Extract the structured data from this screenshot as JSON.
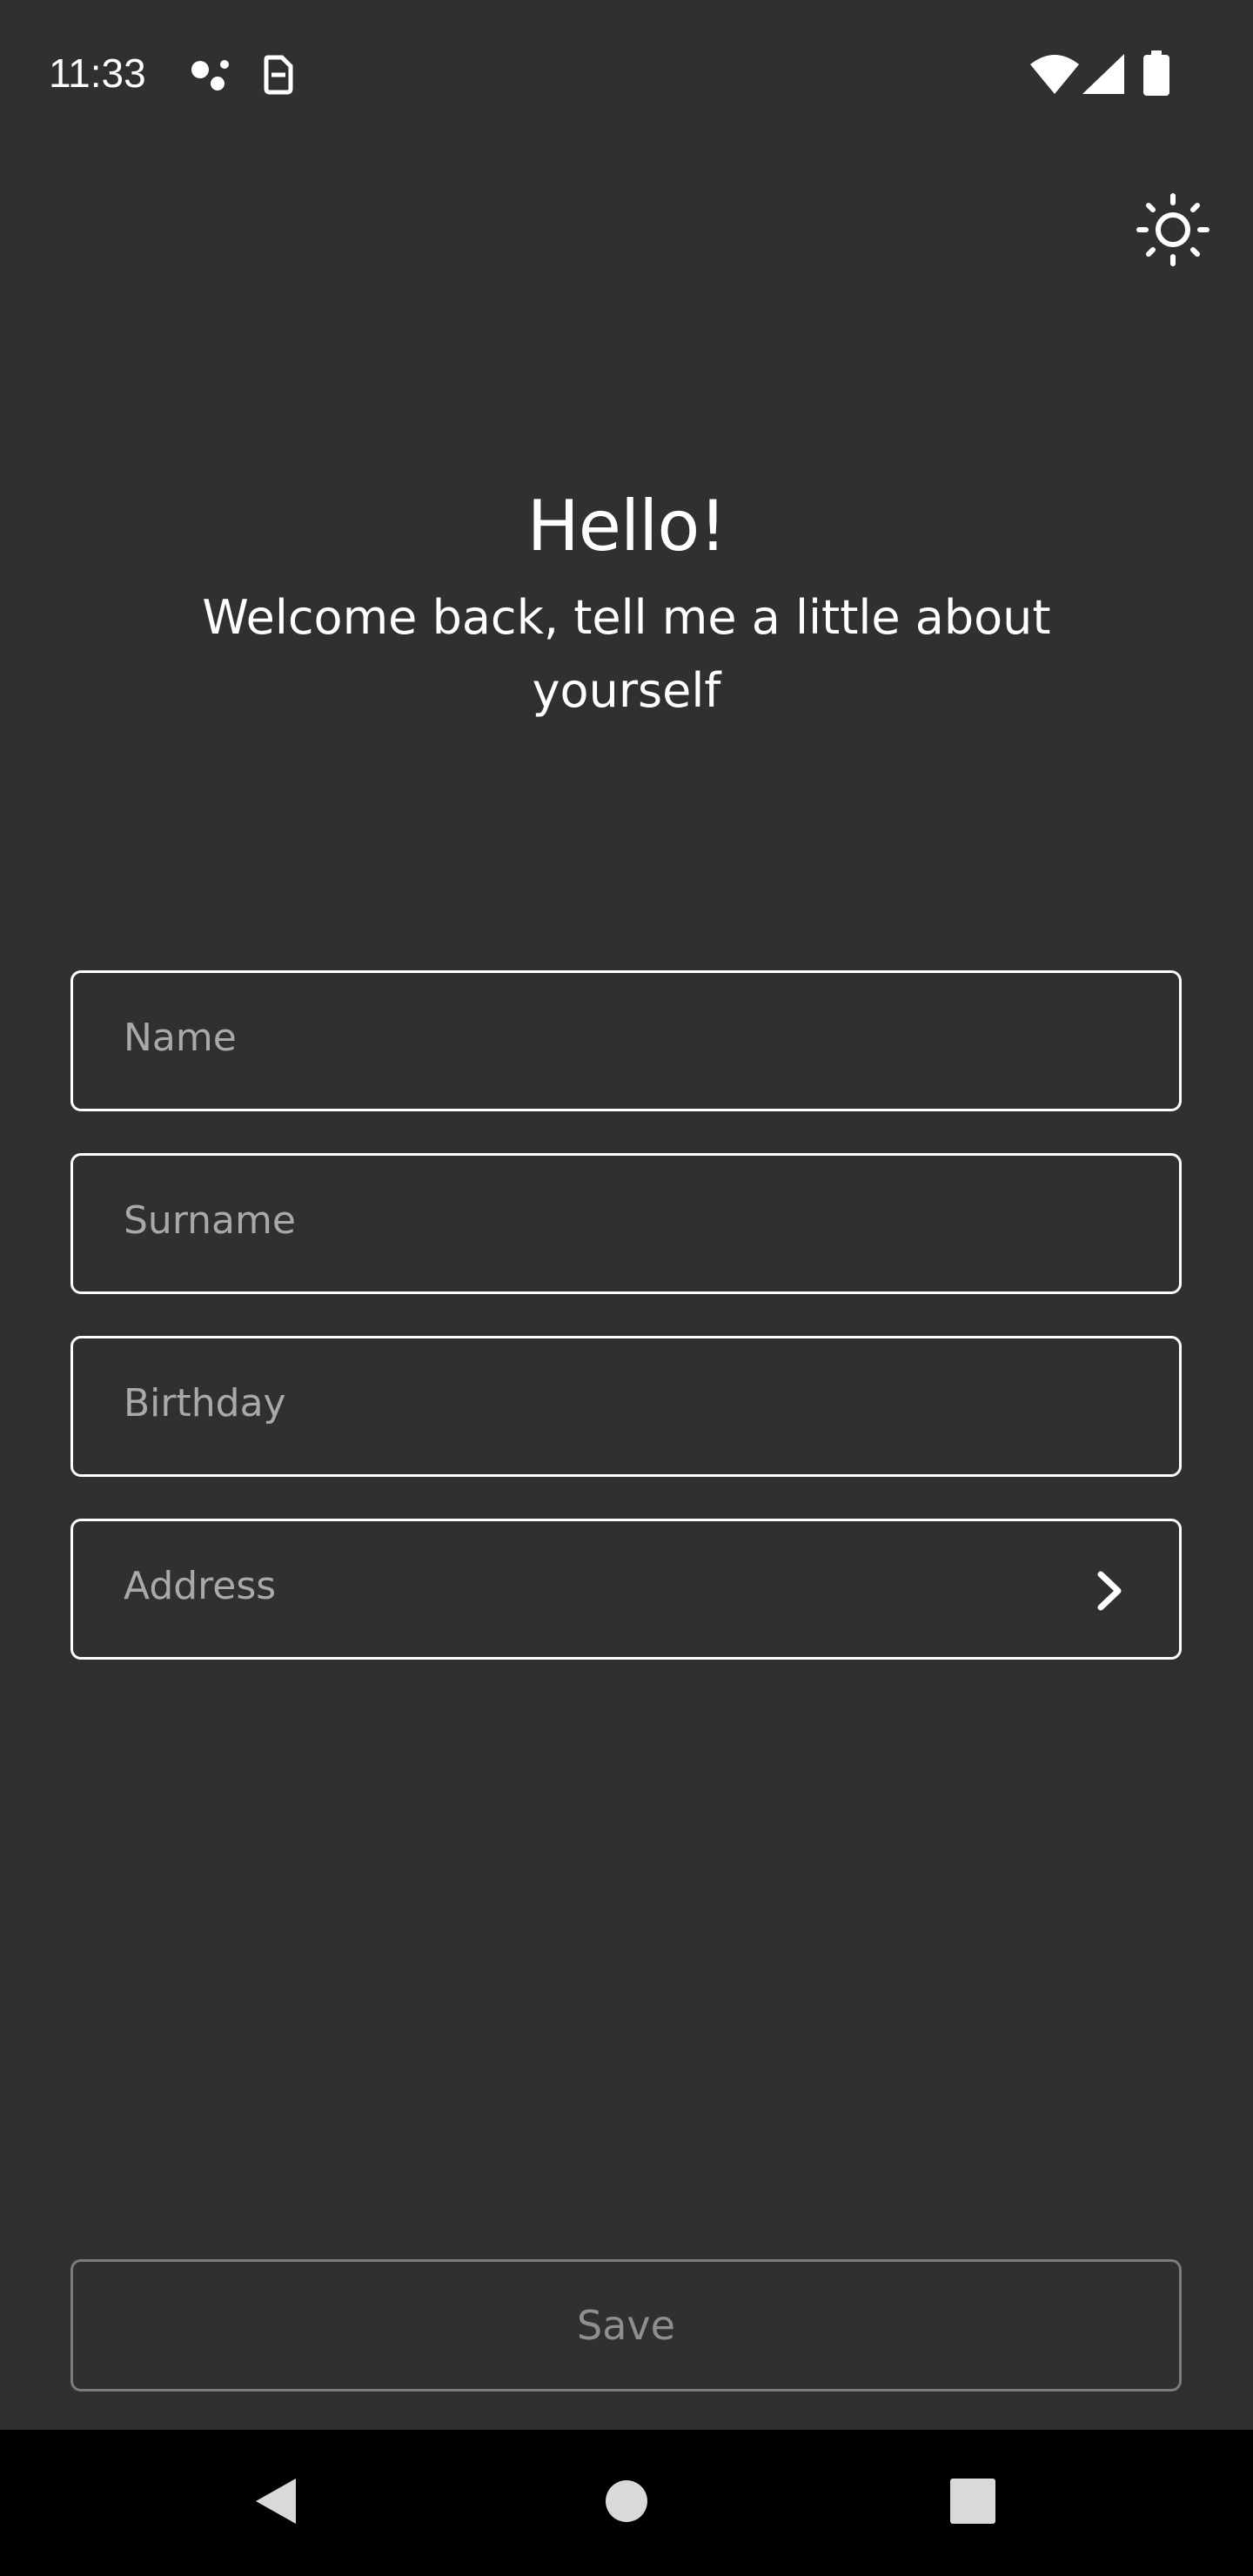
{
  "status_bar": {
    "time": "11:33",
    "icons": [
      "assistant-dots-icon",
      "sim-card-icon",
      "wifi-icon",
      "cellular-signal-icon",
      "battery-icon"
    ]
  },
  "theme_toggle": {
    "icon": "sun-icon"
  },
  "header": {
    "title": "Hello!",
    "subtitle": "Welcome back, tell me a little about yourself"
  },
  "form": {
    "fields": [
      {
        "placeholder": "Name",
        "value": ""
      },
      {
        "placeholder": "Surname",
        "value": ""
      },
      {
        "placeholder": "Birthday",
        "value": ""
      },
      {
        "placeholder": "Address",
        "value": "",
        "icon": "chevron-right-icon"
      }
    ],
    "save_label": "Save"
  },
  "nav_bar": {
    "buttons": [
      "back-icon",
      "home-icon",
      "recents-icon"
    ]
  },
  "colors": {
    "background": "#303030",
    "field_border": "#ffffff",
    "placeholder": "#a9a9a9",
    "save_border_disabled": "#7d7d7d",
    "nav_background": "#000000"
  }
}
